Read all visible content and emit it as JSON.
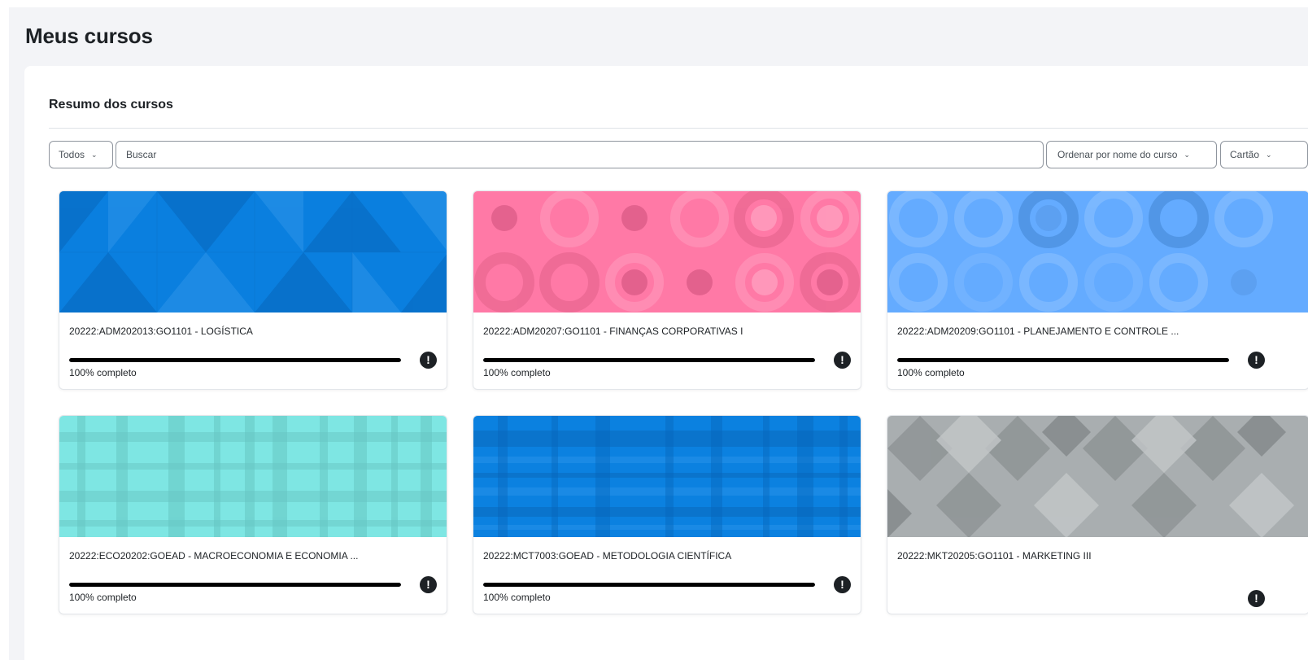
{
  "page": {
    "title": "Meus cursos"
  },
  "overview": {
    "title": "Resumo dos cursos",
    "filter_label": "Todos",
    "search_placeholder": "Buscar",
    "sort_label": "Ordenar por nome do curso",
    "view_label": "Cartão"
  },
  "courses": [
    {
      "name": "20222:ADM202013:GO1101 - LOGÍSTICA",
      "progress_text": "100% completo",
      "progress": 100,
      "color": "#0a7fdf",
      "pattern": "triangles"
    },
    {
      "name": "20222:ADM20207:GO1101 - FINANÇAS CORPORATIVAS I",
      "progress_text": "100% completo",
      "progress": 100,
      "color": "#ff79a6",
      "pattern": "circles"
    },
    {
      "name": "20222:ADM20209:GO1101 - PLANEJAMENTO E CONTROLE ...",
      "progress_text": "100% completo",
      "progress": 100,
      "color": "#64abff",
      "pattern": "circles"
    },
    {
      "name": "20222:ECO20202:GOEAD - MACROECONOMIA E ECONOMIA ...",
      "progress_text": "100% completo",
      "progress": 100,
      "color": "#7ee6e3",
      "pattern": "plaid"
    },
    {
      "name": "20222:MCT7003:GOEAD - METODOLOGIA CIENTÍFICA",
      "progress_text": "100% completo",
      "progress": 100,
      "color": "#0b81e0",
      "pattern": "plaid"
    },
    {
      "name": "20222:MKT20205:GO1101 - MARKETING III",
      "progress_text": "",
      "progress": null,
      "color": "#a9aeb0",
      "pattern": "diamonds"
    }
  ],
  "icons": {
    "chevron": "chevron-down-icon",
    "course_menu": "exclamation-circle-icon"
  }
}
